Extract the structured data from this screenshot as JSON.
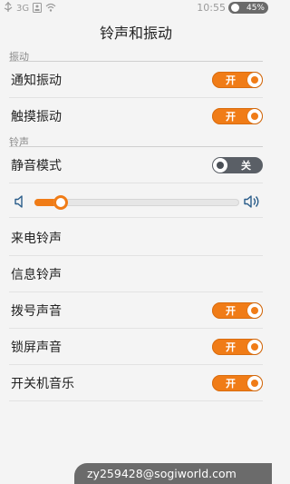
{
  "status_bar": {
    "network": "3G",
    "time": "10:55",
    "battery": "45%"
  },
  "title": "铃声和振动",
  "sections": {
    "vibration": {
      "header": "振动",
      "items": [
        {
          "label": "通知振动",
          "state": "开"
        },
        {
          "label": "触摸振动",
          "state": "开"
        }
      ]
    },
    "ringtone": {
      "header": "铃声",
      "silent": {
        "label": "静音模式",
        "state": "关"
      },
      "volume_level": 0.13,
      "items": [
        {
          "label": "来电铃声"
        },
        {
          "label": "信息铃声"
        },
        {
          "label": "拨号声音",
          "state": "开"
        },
        {
          "label": "锁屏声音",
          "state": "开"
        },
        {
          "label": "开关机音乐",
          "state": "开"
        }
      ]
    }
  },
  "watermark": "zy259428@sogiworld.com",
  "colors": {
    "accent": "#f07c17",
    "toggle_off": "#5a5f66",
    "background": "#f4f4f4"
  }
}
